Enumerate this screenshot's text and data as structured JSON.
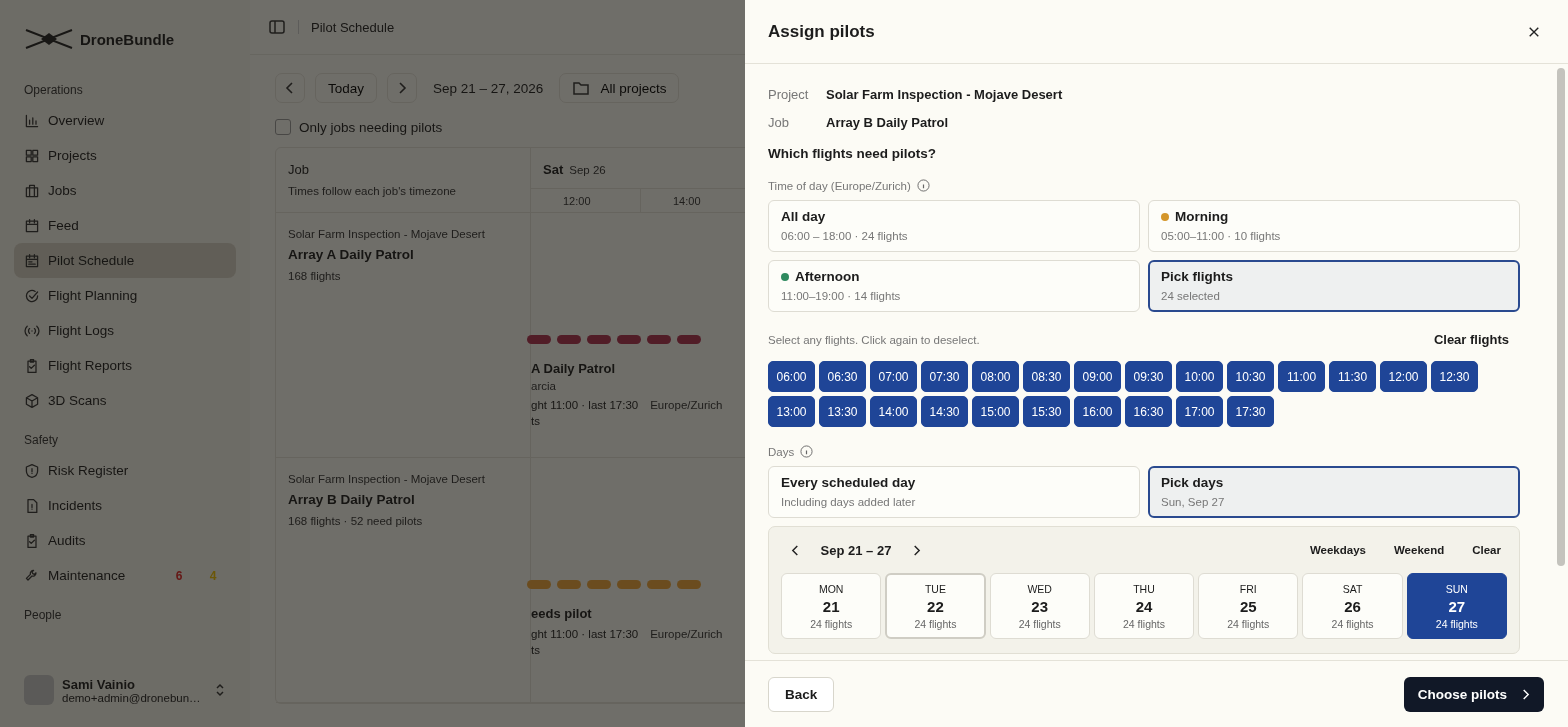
{
  "sidebar": {
    "brand": "DroneBundle",
    "sections": [
      {
        "title": "Operations",
        "items": [
          {
            "label": "Overview",
            "selected": false
          },
          {
            "label": "Projects",
            "selected": false
          },
          {
            "label": "Jobs",
            "selected": false
          },
          {
            "label": "Feed",
            "selected": false
          },
          {
            "label": "Pilot Schedule",
            "selected": true
          },
          {
            "label": "Flight Planning",
            "selected": false
          },
          {
            "label": "Flight Logs",
            "selected": false
          },
          {
            "label": "Flight Reports",
            "selected": false
          },
          {
            "label": "3D Scans",
            "selected": false
          }
        ]
      },
      {
        "title": "Safety",
        "items": [
          {
            "label": "Risk Register",
            "selected": false
          },
          {
            "label": "Incidents",
            "selected": false
          },
          {
            "label": "Audits",
            "selected": false
          },
          {
            "label": "Maintenance",
            "selected": false,
            "badges": [
              {
                "text": "6",
                "kind": "overdue"
              },
              {
                "text": "4",
                "kind": "due"
              }
            ]
          }
        ]
      },
      {
        "title": "People"
      }
    ],
    "user": {
      "name": "Sami Vainio",
      "email": "demo+admin@dronebun…"
    }
  },
  "page": {
    "breadcrumb": "Pilot Schedule",
    "today": "Today",
    "range": "Sep 21 – 27, 2026",
    "projects": "All projects",
    "filter": {
      "label": "Only jobs needing pilots",
      "checked": false
    },
    "table": {
      "job_header": "Job",
      "job_subheader": "Times follow each job's timezone",
      "day": "Sat",
      "date": "Sep 26",
      "times": [
        "12:00",
        "14:00"
      ],
      "rows": [
        {
          "project": "Solar Farm Inspection - Mojave Desert",
          "name": "Array A Daily Patrol",
          "meta": "168 flights",
          "needs_pilot": false,
          "event": {
            "title": "A Daily Patrol",
            "pilot": "arcia",
            "window": "ght 11:00 · last 17:30",
            "timezone": "Europe/Zurich",
            "count": "ts"
          }
        },
        {
          "project": "Solar Farm Inspection - Mojave Desert",
          "name": "Array B Daily Patrol",
          "meta": "168 flights · 52 need pilots",
          "needs_pilot": true,
          "event": {
            "title": "eeds pilot",
            "window": "ght 11:00 · last 17:30",
            "timezone": "Europe/Zurich",
            "count": "ts"
          }
        }
      ]
    }
  },
  "drawer": {
    "title": "Assign pilots",
    "fields": [
      {
        "label": "Project",
        "value": "Solar Farm Inspection - Mojave Desert"
      },
      {
        "label": "Job",
        "value": "Array B Daily Patrol"
      }
    ],
    "question": "Which flights need pilots?",
    "time_label": "Time of day (Europe/Zurich)",
    "time_options": [
      {
        "title": "All day",
        "detail": "06:00 – 18:00 · 24 flights",
        "selected": false
      },
      {
        "title": "Morning",
        "detail": "05:00–11:00 · 10 flights",
        "color": "#d4962a",
        "selected": false
      },
      {
        "title": "Afternoon",
        "detail": "11:00–19:00 · 14 flights",
        "color": "#2f8a5f",
        "selected": false
      },
      {
        "title": "Pick flights",
        "detail": "24 selected",
        "selected": true
      }
    ],
    "flights_hint": "Select any flights. Click again to deselect.",
    "clear_flights": "Clear flights",
    "flights": [
      {
        "time": "06:00",
        "selected": true
      },
      {
        "time": "06:30",
        "selected": true
      },
      {
        "time": "07:00",
        "selected": true
      },
      {
        "time": "07:30",
        "selected": true
      },
      {
        "time": "08:00",
        "selected": true
      },
      {
        "time": "08:30",
        "selected": true
      },
      {
        "time": "09:00",
        "selected": true
      },
      {
        "time": "09:30",
        "selected": true
      },
      {
        "time": "10:00",
        "selected": true
      },
      {
        "time": "10:30",
        "selected": true
      },
      {
        "time": "11:00",
        "selected": true
      },
      {
        "time": "11:30",
        "selected": true
      },
      {
        "time": "12:00",
        "selected": true
      },
      {
        "time": "12:30",
        "selected": true
      },
      {
        "time": "13:00",
        "selected": true
      },
      {
        "time": "13:30",
        "selected": true
      },
      {
        "time": "14:00",
        "selected": true
      },
      {
        "time": "14:30",
        "selected": true
      },
      {
        "time": "15:00",
        "selected": true
      },
      {
        "time": "15:30",
        "selected": true
      },
      {
        "time": "16:00",
        "selected": true
      },
      {
        "time": "16:30",
        "selected": true
      },
      {
        "time": "17:00",
        "selected": true
      },
      {
        "time": "17:30",
        "selected": true
      }
    ],
    "days_label": "Days",
    "day_options": [
      {
        "title": "Every scheduled day",
        "detail": "Including days added later",
        "selected": false
      },
      {
        "title": "Pick days",
        "detail": "Sun, Sep 27",
        "selected": true
      }
    ],
    "week": {
      "range": "Sep 21 – 27",
      "actions": [
        "Weekdays",
        "Weekend",
        "Clear"
      ],
      "days": [
        {
          "weekday": "MON",
          "date": "21",
          "flights": "24 flights",
          "today": false,
          "selected": false
        },
        {
          "weekday": "TUE",
          "date": "22",
          "flights": "24 flights",
          "today": true,
          "selected": false
        },
        {
          "weekday": "WED",
          "date": "23",
          "flights": "24 flights",
          "today": false,
          "selected": false
        },
        {
          "weekday": "THU",
          "date": "24",
          "flights": "24 flights",
          "today": false,
          "selected": false
        },
        {
          "weekday": "FRI",
          "date": "25",
          "flights": "24 flights",
          "today": false,
          "selected": false
        },
        {
          "weekday": "SAT",
          "date": "26",
          "flights": "24 flights",
          "today": false,
          "selected": false
        },
        {
          "weekday": "SUN",
          "date": "27",
          "flights": "24 flights",
          "today": false,
          "selected": true
        }
      ]
    },
    "back": "Back",
    "next": "Choose pilots"
  }
}
